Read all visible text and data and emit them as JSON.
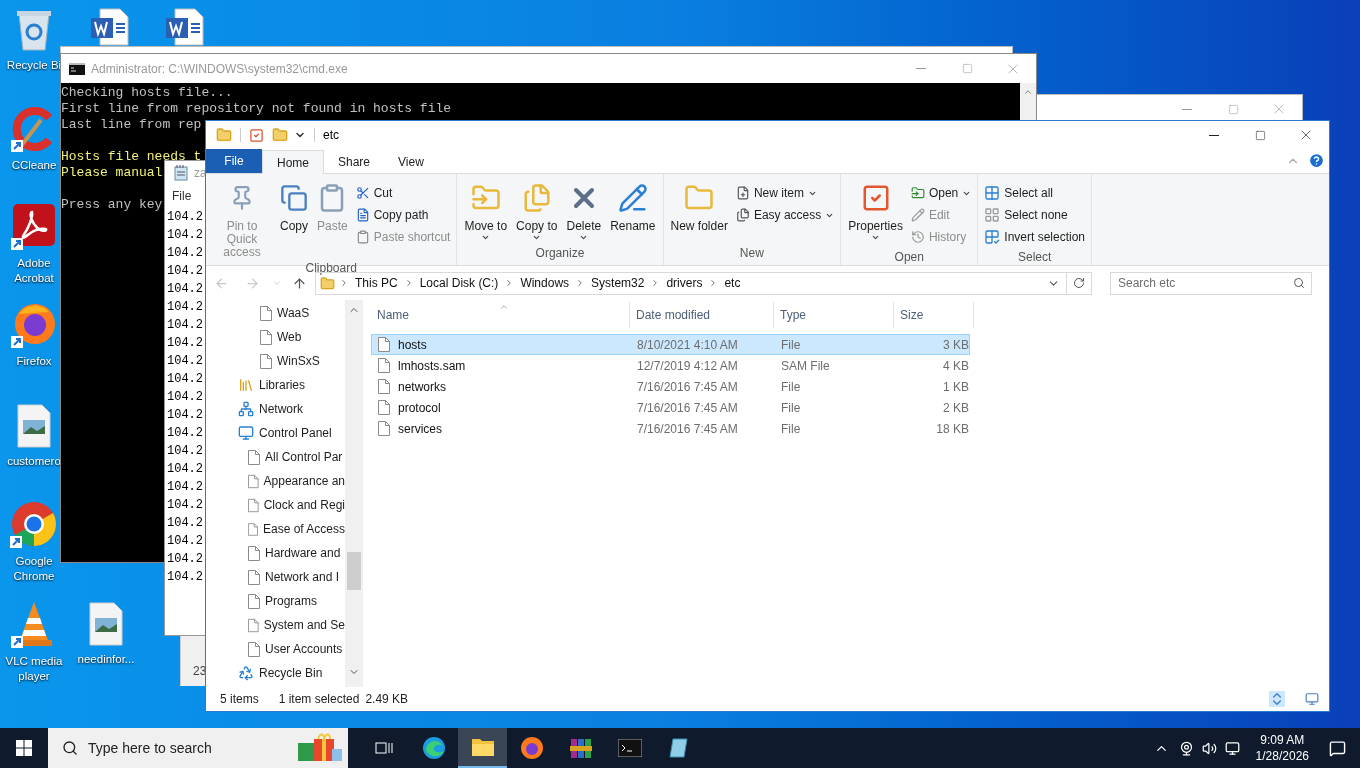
{
  "desktop": {
    "icons": [
      {
        "kind": "recycle",
        "label": "Recycle Bi"
      },
      {
        "kind": "word"
      },
      {
        "kind": "word"
      },
      {
        "kind": "ccleaner",
        "label": "CCleane"
      },
      {
        "kind": "acrobat",
        "label": "Adobe Acrobat"
      },
      {
        "kind": "firefox",
        "label": "Firefox"
      },
      {
        "kind": "image-file",
        "label": "customero"
      },
      {
        "kind": "chrome",
        "label": "Google Chrome"
      },
      {
        "kind": "vlc",
        "label": "VLC media player"
      },
      {
        "kind": "image-file",
        "label": "needinfor..."
      }
    ]
  },
  "cmd": {
    "title": "Administrator: C:\\WINDOWS\\system32\\cmd.exe",
    "lines": [
      {
        "kind": "text",
        "text": "Checking hosts file...",
        "color": "#c0c0c0"
      },
      {
        "kind": "text",
        "text": "First line from repository not found in hosts file",
        "color": "#c0c0c0"
      },
      {
        "kind": "text",
        "text": "Last line from rep",
        "color": "#c0c0c0"
      },
      {
        "kind": "blank"
      },
      {
        "kind": "text",
        "text": "Hosts file needs t",
        "color": "#f2f27a"
      },
      {
        "kind": "text",
        "text": "Please manual",
        "color": "#f2f27a"
      },
      {
        "kind": "blank"
      },
      {
        "kind": "text",
        "text": "Press any key",
        "color": "#c0c0c0"
      }
    ]
  },
  "notepad": {
    "title": "za",
    "menu": [
      "File"
    ],
    "lines": [
      "104.2",
      "104.2",
      "104.2",
      "104.2",
      "104.2",
      "104.2",
      "104.2",
      "104.2",
      "104.2",
      "104.2",
      "104.2",
      "104.2",
      "104.2",
      "104.2",
      "104.2",
      "104.2",
      "104.2",
      "104.2",
      "104.2",
      "104.2",
      "104.2"
    ]
  },
  "other_window": {
    "status": "23"
  },
  "explorer": {
    "title": "etc",
    "tabs": [
      {
        "label": "File",
        "kind": "file",
        "selected": false
      },
      {
        "label": "Home",
        "kind": "tab",
        "selected": true
      },
      {
        "label": "Share",
        "kind": "tab",
        "selected": false
      },
      {
        "label": "View",
        "kind": "tab",
        "selected": false
      }
    ],
    "ribbon": [
      {
        "label": "Clipboard",
        "items": [
          {
            "label": "Pin to Quick access",
            "kind": "large",
            "disabled": true,
            "dropdown": false
          },
          {
            "label": "Copy",
            "kind": "large",
            "disabled": false,
            "dropdown": false
          },
          {
            "label": "Paste",
            "kind": "large",
            "disabled": true,
            "dropdown": false
          },
          {
            "label": "Cut",
            "kind": "small",
            "disabled": false,
            "dropdown": false
          },
          {
            "label": "Copy path",
            "kind": "small",
            "disabled": false,
            "dropdown": false
          },
          {
            "label": "Paste shortcut",
            "kind": "small",
            "disabled": true,
            "dropdown": false
          }
        ]
      },
      {
        "label": "Organize",
        "items": [
          {
            "label": "Move to",
            "kind": "large",
            "disabled": false,
            "dropdown": true
          },
          {
            "label": "Copy to",
            "kind": "large",
            "disabled": false,
            "dropdown": true
          },
          {
            "label": "Delete",
            "kind": "large",
            "disabled": false,
            "dropdown": true
          },
          {
            "label": "Rename",
            "kind": "large",
            "disabled": false,
            "dropdown": false
          }
        ]
      },
      {
        "label": "New",
        "items": [
          {
            "label": "New folder",
            "kind": "large",
            "disabled": false,
            "dropdown": false
          },
          {
            "label": "New item",
            "kind": "small",
            "disabled": false,
            "dropdown": true
          },
          {
            "label": "Easy access",
            "kind": "small",
            "disabled": false,
            "dropdown": true
          }
        ]
      },
      {
        "label": "Open",
        "items": [
          {
            "label": "Properties",
            "kind": "large",
            "disabled": false,
            "dropdown": true
          },
          {
            "label": "Open",
            "kind": "small",
            "disabled": false,
            "dropdown": true
          },
          {
            "label": "Edit",
            "kind": "small",
            "disabled": true,
            "dropdown": false
          },
          {
            "label": "History",
            "kind": "small",
            "disabled": true,
            "dropdown": false
          }
        ]
      },
      {
        "label": "Select",
        "items": [
          {
            "label": "Select all",
            "kind": "small",
            "disabled": false,
            "dropdown": false
          },
          {
            "label": "Select none",
            "kind": "small",
            "disabled": false,
            "dropdown": false
          },
          {
            "label": "Invert selection",
            "kind": "small",
            "disabled": false,
            "dropdown": false
          }
        ]
      }
    ],
    "path": [
      "This PC",
      "Local Disk (C:)",
      "Windows",
      "System32",
      "drivers",
      "etc"
    ],
    "search": {
      "placeholder": "Search etc"
    },
    "nav_pane": {
      "scrolled_items": [
        {
          "label": "WaaS"
        },
        {
          "label": "Web"
        },
        {
          "label": "WinSxS"
        }
      ],
      "items": [
        {
          "kind": "libraries",
          "label": "Libraries"
        },
        {
          "kind": "network",
          "label": "Network"
        },
        {
          "kind": "control-panel",
          "label": "Control Panel",
          "children": [
            {
              "label": "All Control Par"
            },
            {
              "label": "Appearance an"
            },
            {
              "label": "Clock and Regi"
            },
            {
              "label": "Ease of Access"
            },
            {
              "label": "Hardware and"
            },
            {
              "label": "Network and I"
            },
            {
              "label": "Programs"
            },
            {
              "label": "System and Se"
            },
            {
              "label": "User Accounts"
            }
          ]
        },
        {
          "kind": "recycle",
          "label": "Recycle Bin"
        }
      ]
    },
    "columns": [
      "Name",
      "Date modified",
      "Type",
      "Size"
    ],
    "files": [
      {
        "name": "hosts",
        "date": "8/10/2021 4:10 AM",
        "type": "File",
        "size": "3 KB",
        "selected": true
      },
      {
        "name": "lmhosts.sam",
        "date": "12/7/2019 4:12 AM",
        "type": "SAM File",
        "size": "4 KB",
        "selected": false
      },
      {
        "name": "networks",
        "date": "7/16/2016 7:45 AM",
        "type": "File",
        "size": "1 KB",
        "selected": false
      },
      {
        "name": "protocol",
        "date": "7/16/2016 7:45 AM",
        "type": "File",
        "size": "2 KB",
        "selected": false
      },
      {
        "name": "services",
        "date": "7/16/2016 7:45 AM",
        "type": "File",
        "size": "18 KB",
        "selected": false
      }
    ],
    "status": {
      "count": "5 items",
      "selection": "1 item selected",
      "size": "2.49 KB"
    }
  },
  "taskbar": {
    "search": {
      "placeholder": "Type here to search"
    },
    "apps": [
      {
        "kind": "task-view",
        "selected": false
      },
      {
        "kind": "edge",
        "selected": false
      },
      {
        "kind": "explorer",
        "selected": true
      },
      {
        "kind": "firefox",
        "selected": false
      },
      {
        "kind": "winrar",
        "selected": false
      },
      {
        "kind": "cmd",
        "selected": false
      },
      {
        "kind": "app",
        "selected": false
      }
    ],
    "time": "9:09 AM",
    "date": "1/28/2026"
  }
}
